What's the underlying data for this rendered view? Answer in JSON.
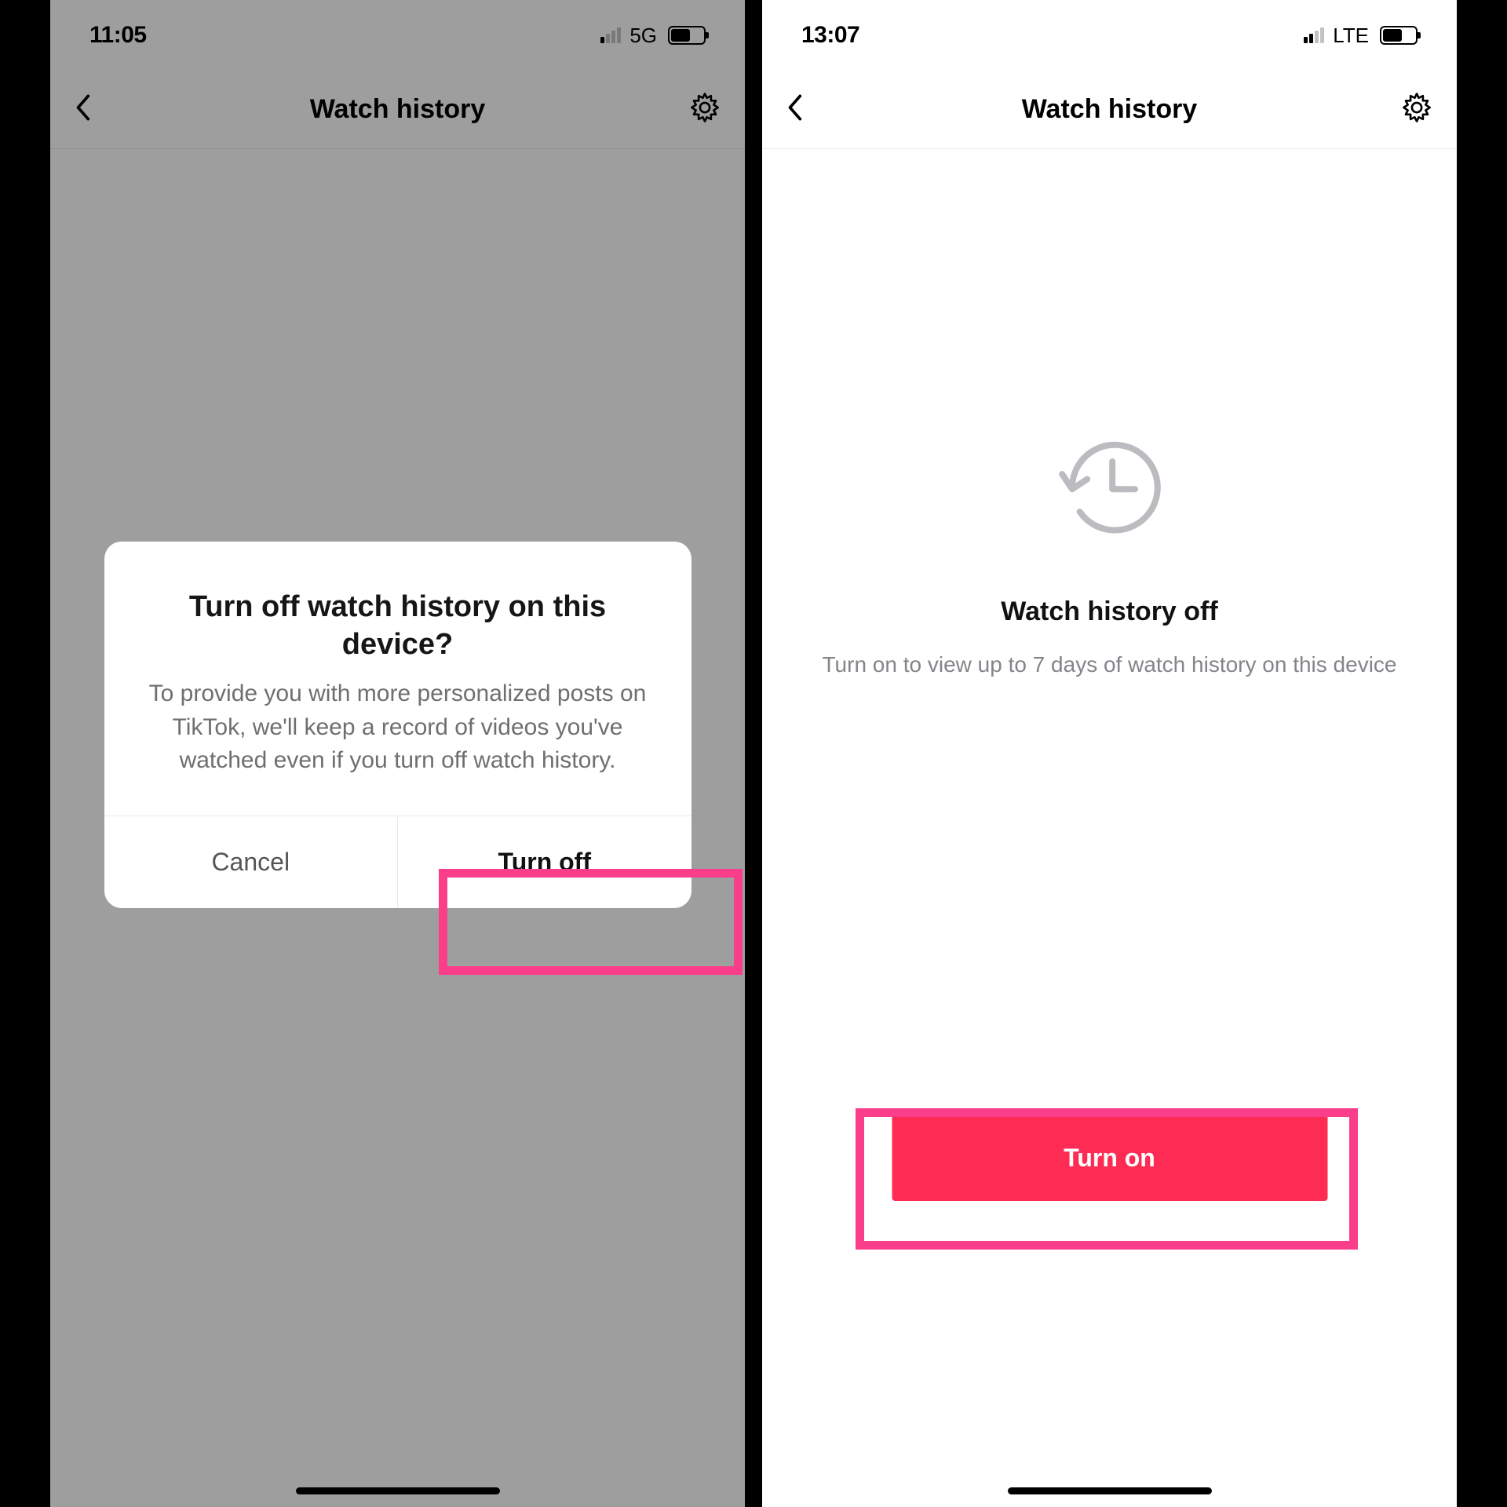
{
  "highlight_color": "#fb3e8a",
  "accent_color": "#fe2c55",
  "left": {
    "status": {
      "time": "11:05",
      "network": "5G",
      "signal_active_bars": 1
    },
    "header": {
      "title": "Watch history"
    },
    "modal": {
      "title": "Turn off watch history on this device?",
      "body": "To provide you with more personalized posts on TikTok, we'll keep a record of videos you've watched even if you turn off watch history.",
      "cancel_label": "Cancel",
      "confirm_label": "Turn off"
    }
  },
  "right": {
    "status": {
      "time": "13:07",
      "network": "LTE",
      "signal_active_bars": 2
    },
    "header": {
      "title": "Watch history"
    },
    "empty": {
      "title": "Watch history off",
      "subtitle": "Turn on to view up to 7 days of watch history on this device"
    },
    "cta_label": "Turn on"
  }
}
